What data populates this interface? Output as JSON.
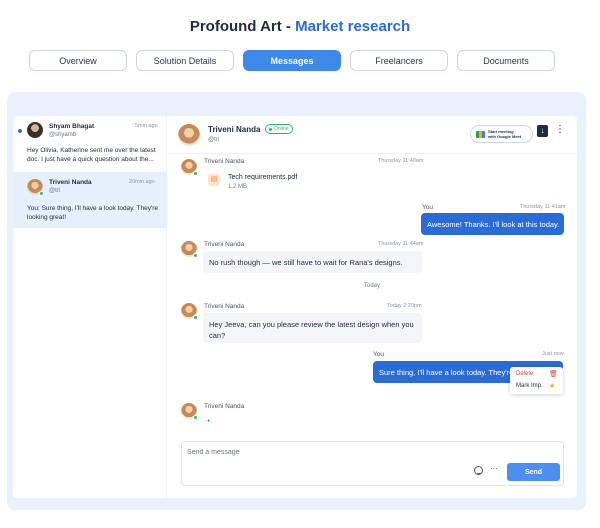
{
  "header": {
    "title": "Profound Art",
    "separator": " - ",
    "subtitle": "Market research"
  },
  "tabs": [
    {
      "label": "Overview"
    },
    {
      "label": "Solution Details"
    },
    {
      "label": "Messages",
      "active": true
    },
    {
      "label": "Freelancers"
    },
    {
      "label": "Documents"
    }
  ],
  "conversations": [
    {
      "name": "Shyam Bhagat",
      "handle": "@shyamb",
      "time": "5min ago",
      "preview": "Hey Olivia, Katherine sent me over the latest doc. I just have a quick question about the...",
      "unread": true
    },
    {
      "name": "Triveni Nanda",
      "handle": "@tri",
      "time": "20min ago",
      "preview": "You: Sure thing, I'll have a look today. They're looking great!",
      "selected": true
    }
  ],
  "chat": {
    "name": "Triveni Nanda",
    "status": "Online",
    "handle": "@tri",
    "meet_button": {
      "line1": "Start meeting",
      "line2": "with Google Meet"
    }
  },
  "messages": {
    "m1": {
      "sender": "Triveni Nanda",
      "time": "Thursday 11:40am",
      "file_name": "Tech requirements.pdf",
      "file_size": "1.2 MB"
    },
    "m2": {
      "sender": "You",
      "time": "Thursday 11:41am",
      "text": "Awesome! Thanks. I'll look at this today."
    },
    "m3": {
      "sender": "Triveni Nanda",
      "time": "Thursday 11:44am",
      "text": "No rush though — we still have to wait for Rana's designs."
    },
    "divider": "Today",
    "m4": {
      "sender": "Triveni Nanda",
      "time": "Today 2:20pm",
      "text": "Hey Jeeva, can you please review the latest design when you can?"
    },
    "m5": {
      "sender": "You",
      "time": "Just now",
      "text": "Sure thing, I'll have a look today. They're looking great!"
    },
    "m6": {
      "sender": "Triveni Nanda"
    }
  },
  "context_menu": {
    "delete_label": "Delete",
    "mark_label": "Mark Imp."
  },
  "composer": {
    "placeholder": "Send a message",
    "send_label": "Send"
  },
  "colors": {
    "accent": "#2b6bd6",
    "tab_active": "#3e88e8",
    "online": "#2fb86b",
    "danger": "#e03a3a"
  }
}
